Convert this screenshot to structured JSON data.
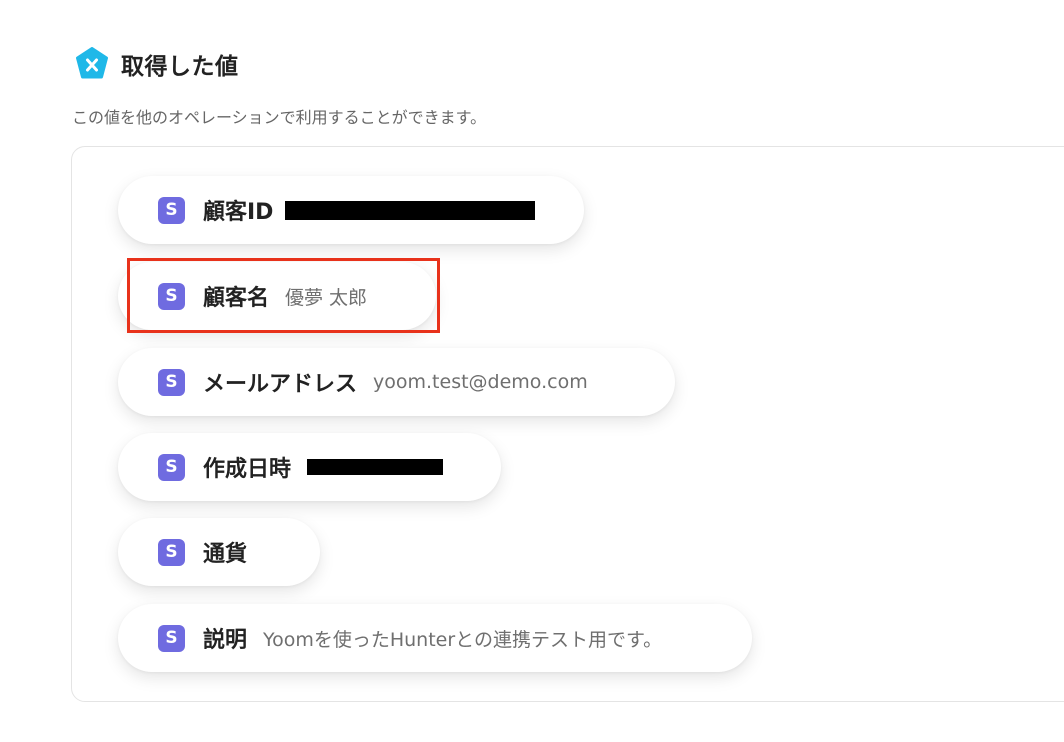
{
  "header": {
    "logo_icon": "yoom-x-pentagon-icon",
    "logo_color": "#1fb8e8",
    "title": "取得した値",
    "subtitle": "この値を他のオペレーションで利用することができます。"
  },
  "fields": [
    {
      "icon": "stripe-s-icon",
      "icon_letter": "S",
      "label": "顧客ID",
      "value": "",
      "redacted": true
    },
    {
      "icon": "stripe-s-icon",
      "icon_letter": "S",
      "label": "顧客名",
      "value": "優夢 太郎",
      "highlighted": true
    },
    {
      "icon": "stripe-s-icon",
      "icon_letter": "S",
      "label": "メールアドレス",
      "value": "yoom.test@demo.com"
    },
    {
      "icon": "stripe-s-icon",
      "icon_letter": "S",
      "label": "作成日時",
      "value": "",
      "redacted": true
    },
    {
      "icon": "stripe-s-icon",
      "icon_letter": "S",
      "label": "通貨",
      "value": ""
    },
    {
      "icon": "stripe-s-icon",
      "icon_letter": "S",
      "label": "説明",
      "value": "Yoomを使ったHunterとの連携テスト用です。"
    }
  ],
  "colors": {
    "icon_bg": "#6f6be0",
    "highlight_border": "#e8321b"
  }
}
